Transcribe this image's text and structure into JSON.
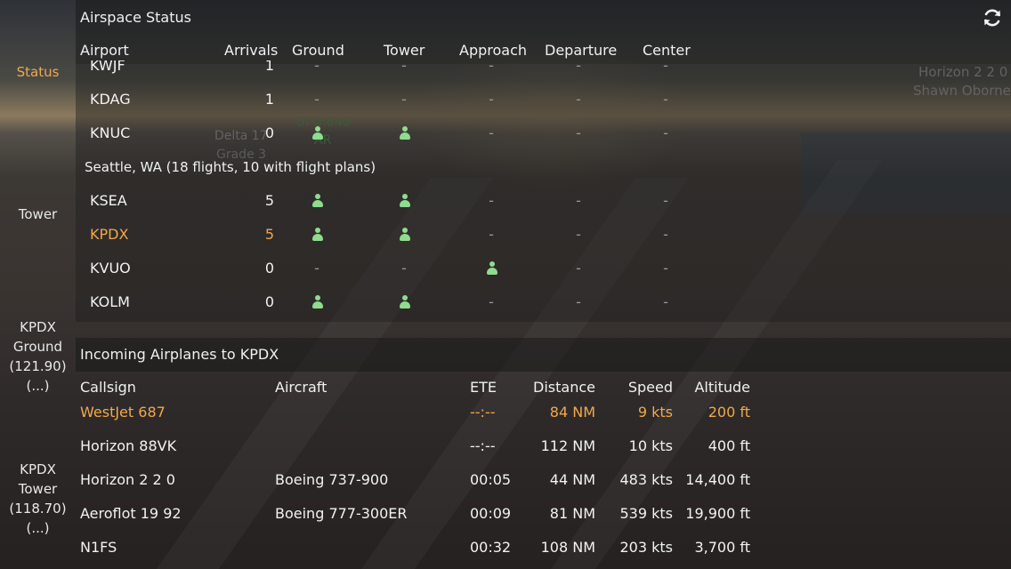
{
  "scene": {
    "aircraft_label_1": "Delta 17",
    "aircraft_label_2": "Grade 3",
    "aircraft_label_3": "UFO 640",
    "aircraft_label_4": "AR",
    "corner_label_1": "Horizon 2 2 0",
    "corner_label_2": "Shawn Oborne"
  },
  "sidebar": {
    "items": [
      {
        "label": "Status"
      },
      {
        "label": "Tower"
      },
      {
        "label_lines": [
          "KPDX",
          "Ground",
          "(121.90)",
          "(...)"
        ]
      },
      {
        "label_lines": [
          "KPDX",
          "Tower",
          "(118.70)",
          "(...)"
        ]
      }
    ]
  },
  "airspace": {
    "title": "Airspace Status",
    "columns": [
      "Airport",
      "Arrivals",
      "Ground",
      "Tower",
      "Approach",
      "Departure",
      "Center"
    ],
    "rows_top": [
      {
        "airport": "KWJF",
        "arrivals": "1",
        "ground": "-",
        "tower": "-",
        "approach": "-",
        "departure": "-",
        "center": "-"
      },
      {
        "airport": "KDAG",
        "arrivals": "1",
        "ground": "-",
        "tower": "-",
        "approach": "-",
        "departure": "-",
        "center": "-"
      },
      {
        "airport": "KNUC",
        "arrivals": "0",
        "ground": "person-icon",
        "tower": "person-icon",
        "approach": "-",
        "departure": "-",
        "center": "-"
      }
    ],
    "region_label": "Seattle, WA (18 flights, 10 with flight plans)",
    "rows_region": [
      {
        "airport": "KSEA",
        "arrivals": "5",
        "ground": "person-icon",
        "tower": "person-icon",
        "approach": "-",
        "departure": "-",
        "center": "-",
        "highlight": false
      },
      {
        "airport": "KPDX",
        "arrivals": "5",
        "ground": "person-icon",
        "tower": "person-icon",
        "approach": "-",
        "departure": "-",
        "center": "-",
        "highlight": true
      },
      {
        "airport": "KVUO",
        "arrivals": "0",
        "ground": "-",
        "tower": "-",
        "approach": "person-icon",
        "departure": "-",
        "center": "-",
        "highlight": false
      },
      {
        "airport": "KOLM",
        "arrivals": "0",
        "ground": "person-icon",
        "tower": "person-icon",
        "approach": "-",
        "departure": "-",
        "center": "-",
        "highlight": false
      }
    ]
  },
  "incoming": {
    "title": "Incoming Airplanes to KPDX",
    "columns": [
      "Callsign",
      "Aircraft",
      "ETE",
      "Distance",
      "Speed",
      "Altitude"
    ],
    "rows": [
      {
        "callsign": "WestJet 687",
        "aircraft": "",
        "ete": "--:--",
        "distance": "84 NM",
        "speed": "9 kts",
        "altitude": "200 ft",
        "highlight": true
      },
      {
        "callsign": "Horizon 88VK",
        "aircraft": "",
        "ete": "--:--",
        "distance": "112 NM",
        "speed": "10 kts",
        "altitude": "400 ft",
        "highlight": false
      },
      {
        "callsign": "Horizon 2 2 0",
        "aircraft": "Boeing 737-900",
        "ete": "00:05",
        "distance": "44 NM",
        "speed": "483 kts",
        "altitude": "14,400 ft",
        "highlight": false
      },
      {
        "callsign": "Aeroflot 19 92",
        "aircraft": "Boeing 777-300ER",
        "ete": "00:09",
        "distance": "81 NM",
        "speed": "539 kts",
        "altitude": "19,900 ft",
        "highlight": false
      },
      {
        "callsign": "N1FS",
        "aircraft": "",
        "ete": "00:32",
        "distance": "108 NM",
        "speed": "203 kts",
        "altitude": "3,700 ft",
        "highlight": false
      }
    ]
  },
  "icons": {
    "refresh": "refresh-icon",
    "controller": "person-icon"
  },
  "colors": {
    "accent": "#f0a94c",
    "controller_icon": "#8fdc8f"
  }
}
